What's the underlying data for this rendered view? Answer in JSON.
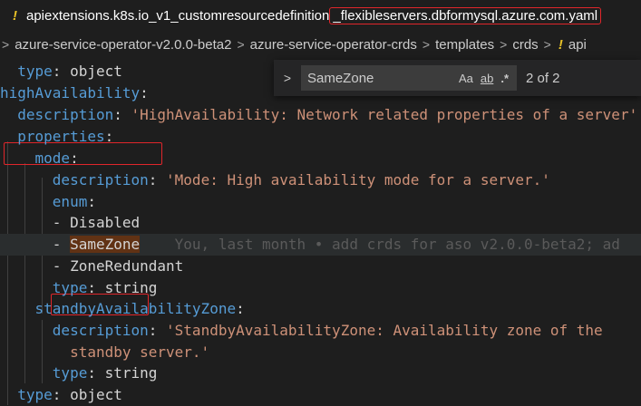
{
  "tab": {
    "icon": "yaml-exclamation-icon",
    "title_prefix": "apiextensions.k8s.io_v1_customresourcedefinition",
    "title_highlight": "_flexibleservers.dbformysql.azure.com.yaml"
  },
  "breadcrumb": {
    "items": [
      "azure-service-operator-v2.0.0-beta2",
      "azure-service-operator-crds",
      "templates",
      "crds",
      "api"
    ]
  },
  "find": {
    "query": "SameZone",
    "options": [
      "Aa",
      "ab",
      ".*"
    ],
    "count": "2 of 2"
  },
  "code": {
    "l1_key": "type",
    "l1_val": "object",
    "l2_key": "highAvailability",
    "l3_key": "description",
    "l3_val": "'HighAvailability: Network related properties of a server'",
    "l4_key": "properties",
    "l5_key": "mode",
    "l6_key": "description",
    "l6_val": "'Mode: High availability mode for a server.'",
    "l7_key": "enum",
    "l8_val": "Disabled",
    "l9_val": "SameZone",
    "l9_blame": "You, last month • add crds for aso v2.0.0-beta2; ad",
    "l10_val": "ZoneRedundant",
    "l11_key": "type",
    "l11_val": "string",
    "l12_key": "standbyAvailabilityZone",
    "l13_key": "description",
    "l13_val": "'StandbyAvailabilityZone: Availability zone of the",
    "l14_val": "standby server.'",
    "l15_key": "type",
    "l15_val": "string",
    "l16_key": "type",
    "l16_val": "object"
  }
}
